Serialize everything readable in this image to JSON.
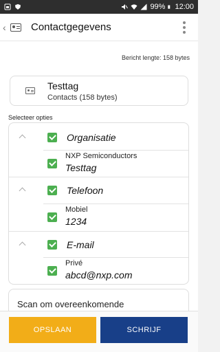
{
  "status_bar": {
    "battery_percent": "99%",
    "time": "12:00"
  },
  "app_bar": {
    "title": "Contactgegevens"
  },
  "message_length": "Bericht lengte: 158 bytes",
  "record": {
    "title": "Testtag",
    "subtitle": "Contacts (158 bytes)"
  },
  "select_options_label": "Selecteer opties",
  "groups": [
    {
      "label": "Organisatie",
      "item": {
        "label": "NXP Semiconductors",
        "value": "Testtag"
      }
    },
    {
      "label": "Telefoon",
      "item": {
        "label": "Mobiel",
        "value": "1234"
      }
    },
    {
      "label": "E-mail",
      "item": {
        "label": "Privé",
        "value": "abcd@nxp.com"
      }
    }
  ],
  "scan_text": "Scan om overeenkomende",
  "buttons": {
    "save": "OPSLAAN",
    "write": "SCHRIJF"
  },
  "colors": {
    "save_button": "#f2ad18",
    "write_button": "#183f88",
    "checkbox": "#4caf50",
    "status_bar": "#2e2e2e"
  }
}
